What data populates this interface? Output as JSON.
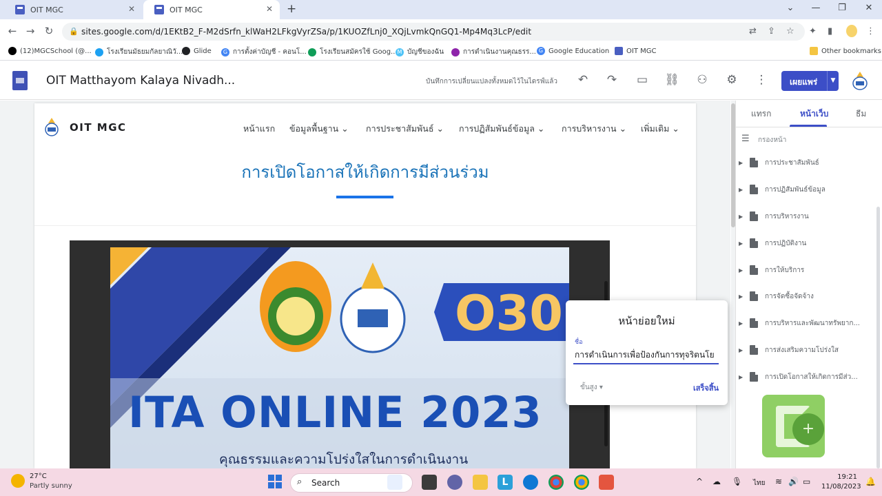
{
  "browser": {
    "tabs": [
      {
        "title": "OIT MGC",
        "active": false
      },
      {
        "title": "OIT MGC",
        "active": true
      }
    ],
    "new_tab_icon": "plus-icon",
    "url": "sites.google.com/d/1EKtB2_F-M2dSrfn_klWaH2LFkgVyrZSa/p/1KUOZfLnj0_XQjLvmkQnGQ1-Mp4Mq3LcP/edit",
    "bookmarks": [
      {
        "label": "(12)MGCSchool (@...",
        "icon_color": "#000000"
      },
      {
        "label": "โรงเรียนมัธยมกัลยาณิวั...",
        "icon_color": "#1da1f2"
      },
      {
        "label": "Glide",
        "icon_color": "#202124"
      },
      {
        "label": "การตั้งค่าบัญชี - คอนโ...",
        "icon_color": "#4285f4"
      },
      {
        "label": "โรงเรียนสมัครใช้ Goog...",
        "icon_color": "#0f9d58"
      },
      {
        "label": "บัญชีของฉัน",
        "icon_color": "#4fc3f7"
      },
      {
        "label": "การดำเนินงานคุณธรร...",
        "icon_color": "#8e24aa"
      },
      {
        "label": "Google Education",
        "icon_color": "#4285f4"
      },
      {
        "label": "OIT MGC",
        "icon_color": "#4a5fc1"
      }
    ],
    "other_bookmarks": "Other bookmarks"
  },
  "app": {
    "doc_title": "OIT Matthayom Kalaya Nivadh...",
    "save_status": "บันทึกการเปลี่ยนแปลงทั้งหมดไว้ในไดรฟ์แล้ว",
    "publish_label": "เผยแพร่"
  },
  "site": {
    "name": "OIT MGC",
    "nav": [
      "หน้าแรก",
      "ข้อมูลพื้นฐาน",
      "การประชาสัมพันธ์",
      "การปฏิสัมพันธ์ข้อมูล",
      "การบริหารงาน",
      "เพิ่มเติม"
    ],
    "page_heading": "การเปิดโอกาสให้เกิดการมีส่วนร่วม",
    "banner": {
      "badge": "O30",
      "title": "ITA ONLINE 2023",
      "subtitle": "คุณธรรมและความโปร่งใสในการดำเนินงาน"
    }
  },
  "panel": {
    "tabs": [
      "แทรก",
      "หน้าเว็บ",
      "ธีม"
    ],
    "active_tab": 1,
    "filter_placeholder": "กรองหน้า",
    "pages": [
      "การประชาสัมพันธ์",
      "การปฏิสัมพันธ์ข้อมูล",
      "การบริหารงาน",
      "การปฏิบัติงาน",
      "การให้บริการ",
      "การจัดซื้อจัดจ้าง",
      "การบริหารและพัฒนาทรัพยาก...",
      "การส่งเสริมความโปร่งใส",
      "การเปิดโอกาสให้เกิดการมีส่ว..."
    ]
  },
  "dialog": {
    "title": "หน้าย่อยใหม่",
    "name_label": "ชื่อ",
    "name_value": "การดำเนินการเพื่อป้องกันการทุจริตนโย",
    "advanced_label": "ขั้นสูง",
    "done_label": "เสร็จสิ้น"
  },
  "taskbar": {
    "weather_temp": "27°C",
    "weather_desc": "Partly sunny",
    "search_label": "Search",
    "lang": "ไทย",
    "time": "19:21",
    "date": "11/08/2023"
  },
  "colors": {
    "accent": "#3c4ec7",
    "heading": "#1a73b8",
    "banner_title": "#1a4fb5",
    "taskbar": "#f5d9e4"
  }
}
